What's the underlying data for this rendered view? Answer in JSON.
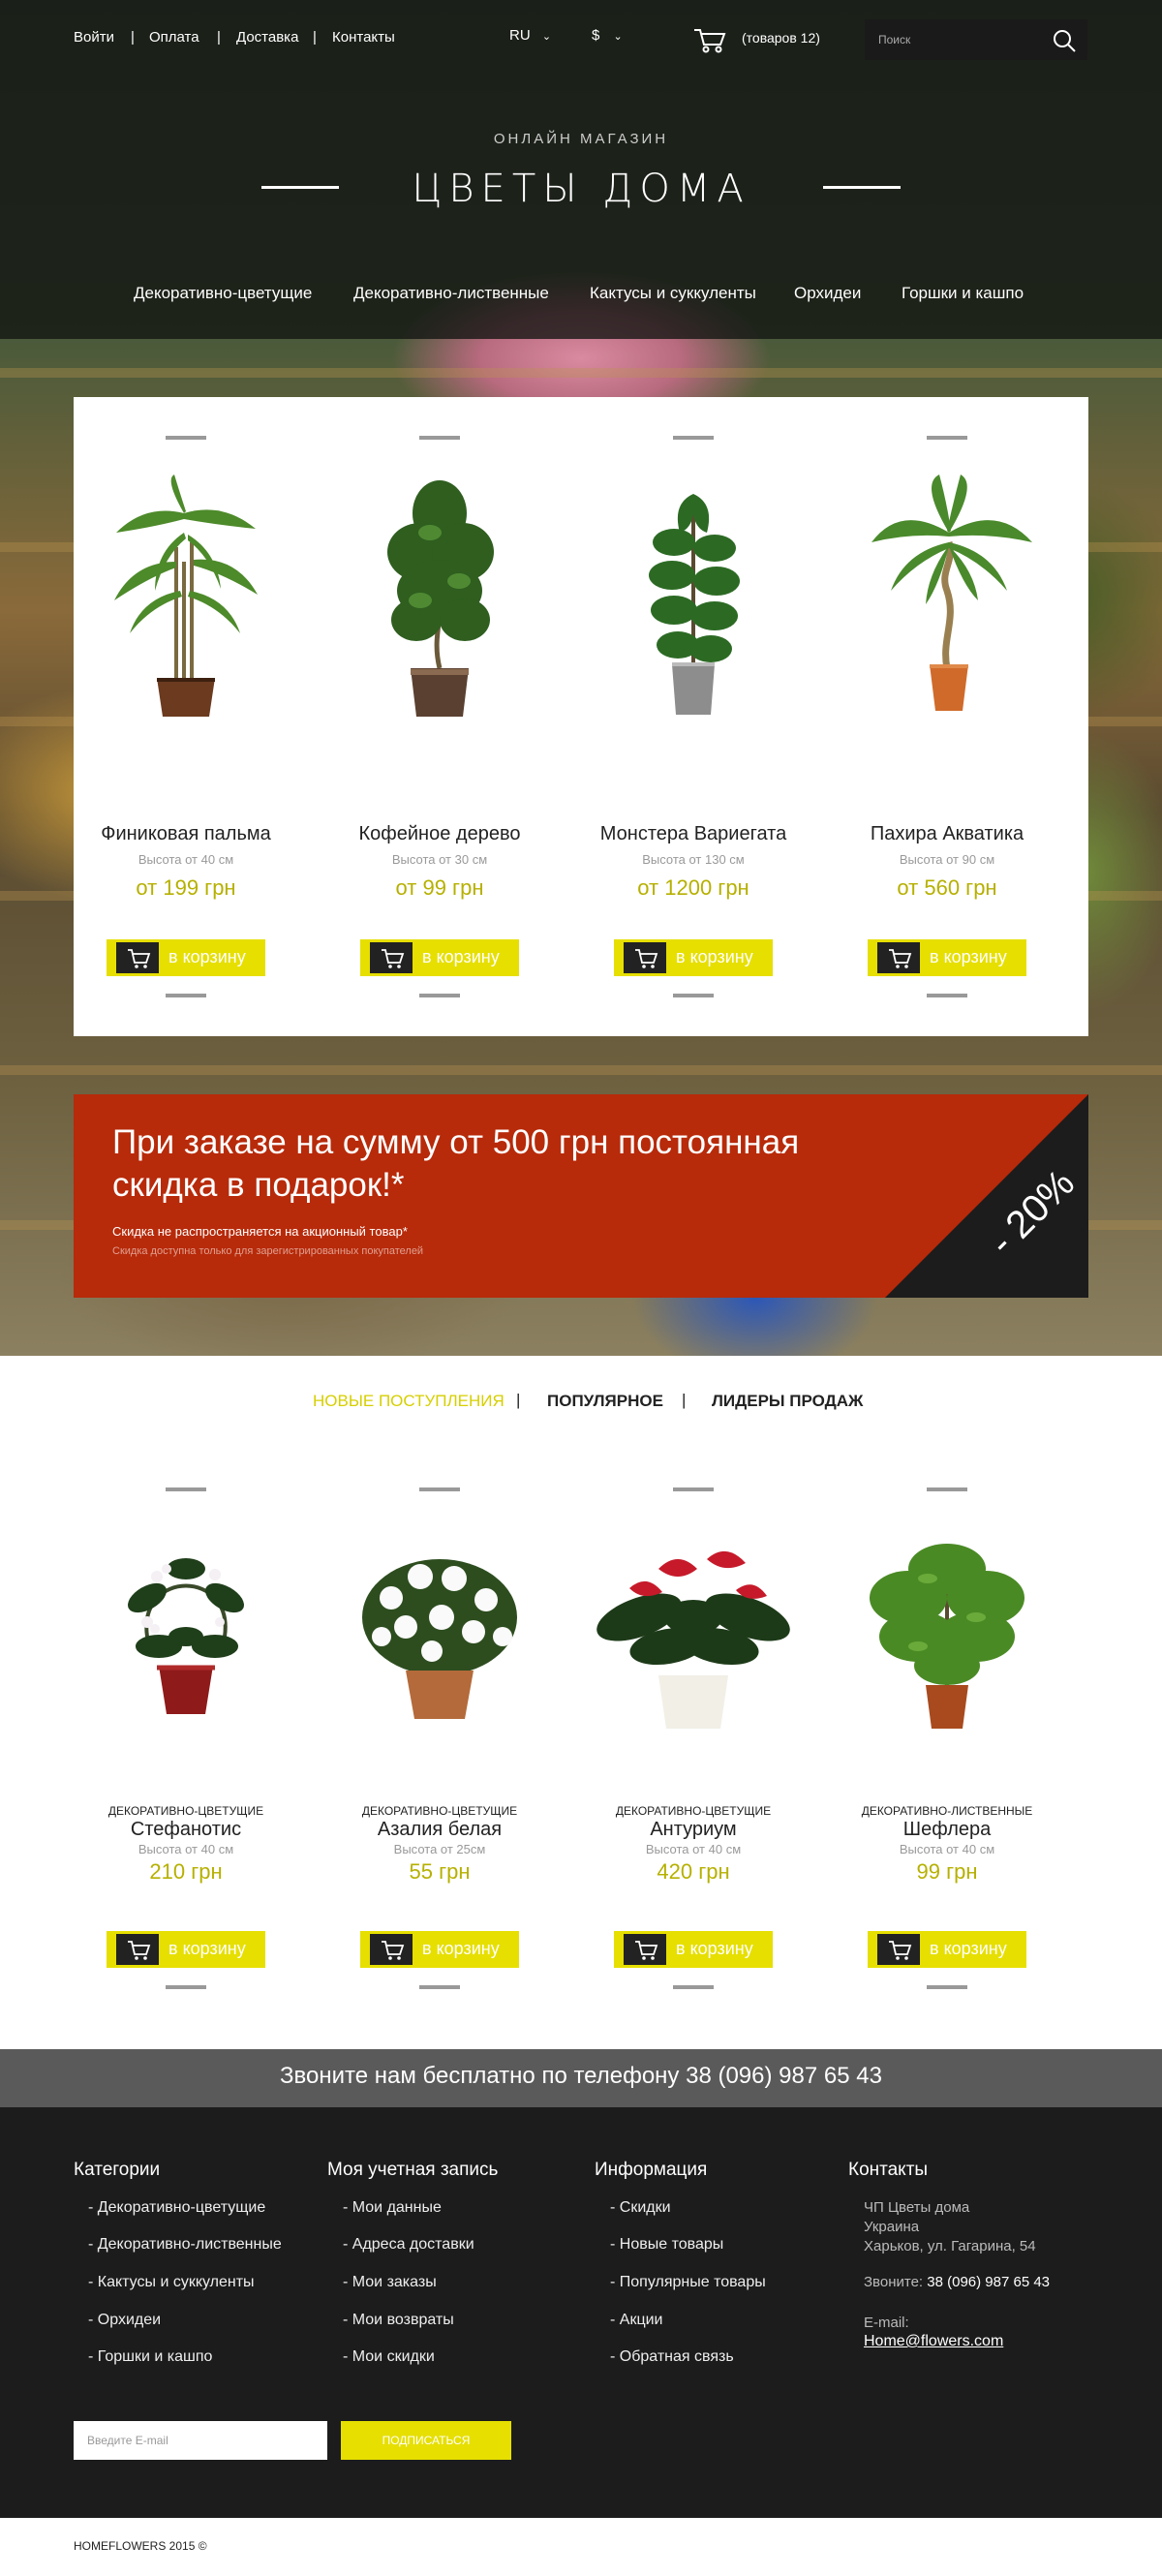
{
  "topbar": {
    "links": [
      "Войти",
      "Оплата",
      "Доставка",
      "Контакты"
    ],
    "separator": "|",
    "language": "RU",
    "currency": "$",
    "cart_label": "(товаров 12)",
    "search_placeholder": "Поиск"
  },
  "brand": {
    "subtitle": "ОНЛАЙН МАГАЗИН",
    "title": "ЦВЕТЫ ДОМА"
  },
  "category_nav": [
    "Декоративно-цветущие",
    "Декоративно-лиственные",
    "Кактусы и суккуленты",
    "Орхидеи",
    "Горшки и кашпо"
  ],
  "featured": [
    {
      "name": "Финиковая пальма",
      "height": "Высота от 40 см",
      "price": "от 199 грн",
      "button": "в корзину"
    },
    {
      "name": "Кофейное дерево",
      "height": "Высота от 30 см",
      "price": "от 99 грн",
      "button": "в корзину"
    },
    {
      "name": "Монстера Вариегата",
      "height": "Высота от 130 см",
      "price": "от 1200 грн",
      "button": "в корзину"
    },
    {
      "name": "Пахира Акватика",
      "height": "Высота от 90 см",
      "price": "от 560 грн",
      "button": "в корзину"
    }
  ],
  "promo": {
    "headline_1": "При заказе на сумму от 500 грн постоянная",
    "headline_2": "скидка в подарок!*",
    "note_1": "Скидка не распространяется на акционный товар*",
    "note_2": "Скидка доступна только для зарегистрированных покупателей",
    "discount": "- 20%"
  },
  "tabs": {
    "items": [
      "НОВЫЕ ПОСТУПЛЕНИЯ",
      "ПОПУЛЯРНОЕ",
      "ЛИДЕРЫ ПРОДАЖ"
    ],
    "active": "НОВЫЕ ПОСТУПЛЕНИЯ",
    "separator": "|"
  },
  "new_products": [
    {
      "category": "ДЕКОРАТИВНО-ЦВЕТУЩИЕ",
      "name": "Стефанотис",
      "height": "Высота от 40 см",
      "price": "210 грн",
      "button": "в корзину"
    },
    {
      "category": "ДЕКОРАТИВНО-ЦВЕТУЩИЕ",
      "name": "Азалия белая",
      "height": "Высота от 25см",
      "price": "55 грн",
      "button": "в корзину"
    },
    {
      "category": "ДЕКОРАТИВНО-ЦВЕТУЩИЕ",
      "name": "Антуриум",
      "height": "Высота от 40 см",
      "price": "420 грн",
      "button": "в корзину"
    },
    {
      "category": "ДЕКОРАТИВНО-ЛИСТВЕННЫЕ",
      "name": "Шефлера",
      "height": "Высота от 40 см",
      "price": "99 грн",
      "button": "в корзину"
    }
  ],
  "phone_banner": "Звоните нам бесплатно по телефону 38 (096) 987 65 43",
  "footer": {
    "columns": [
      {
        "title": "Категории",
        "links": [
          "- Декоративно-цветущие",
          "- Декоративно-лиственные",
          "- Кактусы и суккуленты",
          "- Орхидеи",
          "- Горшки и кашпо"
        ]
      },
      {
        "title": "Моя учетная запись",
        "links": [
          "- Мои данные",
          "- Адреса доставки",
          "- Мои заказы",
          "- Мои возвраты",
          "- Мои скидки"
        ]
      },
      {
        "title": "Информация",
        "links": [
          "- Скидки",
          "- Новые товары",
          "- Популярные товары",
          "- Акции",
          "- Обратная связь"
        ]
      }
    ],
    "contacts": {
      "title": "Контакты",
      "company": "ЧП Цветы дома",
      "country": "Украина",
      "address": "Харьков, ул. Гагарина, 54",
      "phone_label": "Звоните:",
      "phone": "38 (096) 987 65 43",
      "email_label": "E-mail:",
      "email": "Home@flowers.com"
    },
    "subscribe": {
      "placeholder": "Введите E-mail",
      "button": "ПОДПИСАТЬСЯ"
    }
  },
  "copyright": "HOMEFLOWERS 2015 ©",
  "colors": {
    "accent_yellow": "#e6df00",
    "price_olive": "#b6b000",
    "promo_red": "#b72a0a",
    "footer_dark": "#1c1c1c",
    "phone_band": "#5a5a5a"
  }
}
